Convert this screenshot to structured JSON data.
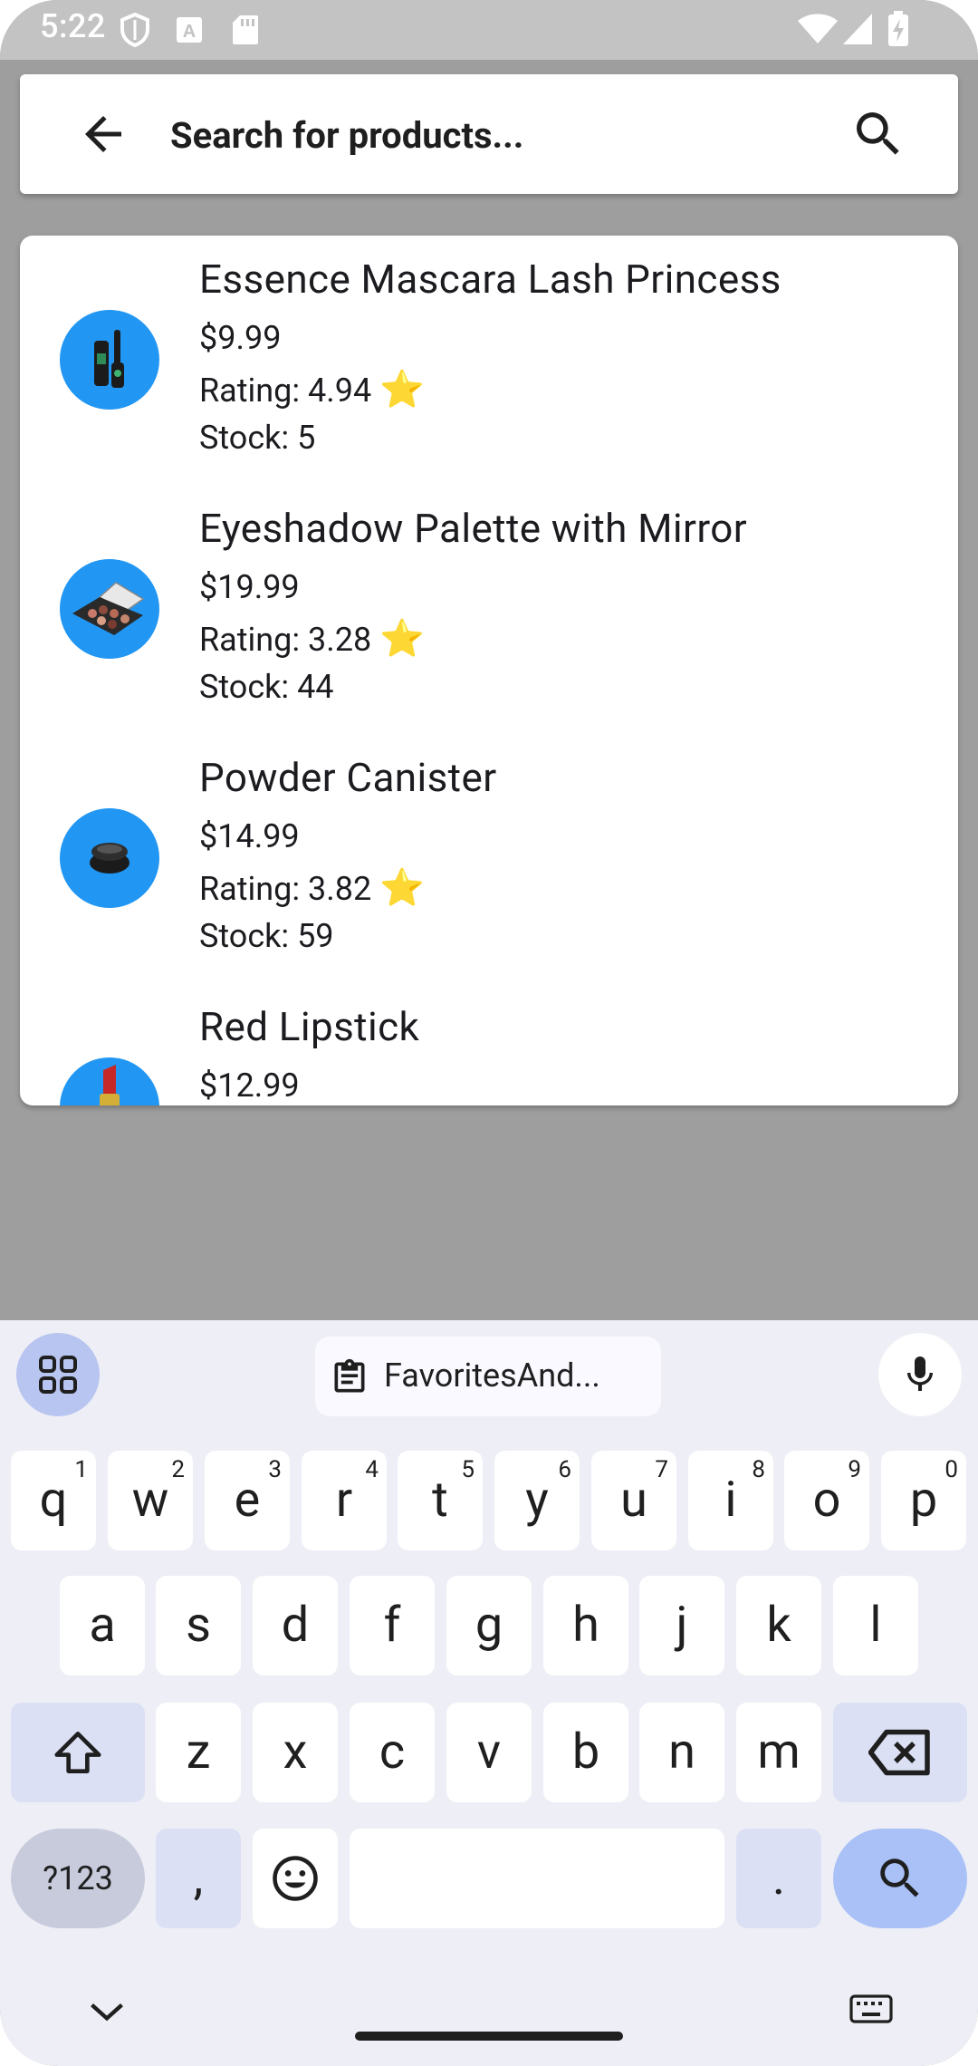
{
  "status_bar": {
    "time": "5:22",
    "icons": [
      "shield-icon",
      "a-icon",
      "sd-card-icon",
      "wifi-icon",
      "signal-icon",
      "battery-charging-icon"
    ]
  },
  "search": {
    "placeholder": "Search for products...",
    "back_icon": "arrow-back-icon",
    "search_icon": "search-icon"
  },
  "products": [
    {
      "name": "Essence Mascara Lash Princess",
      "price": "$9.99",
      "rating": "Rating: 4.94",
      "stock": "Stock: 5",
      "icon": "mascara-icon"
    },
    {
      "name": "Eyeshadow Palette with Mirror",
      "price": "$19.99",
      "rating": "Rating: 3.28",
      "stock": "Stock: 44",
      "icon": "eyeshadow-palette-icon"
    },
    {
      "name": "Powder Canister",
      "price": "$14.99",
      "rating": "Rating: 3.82",
      "stock": "Stock: 59",
      "icon": "powder-canister-icon"
    },
    {
      "name": "Red Lipstick",
      "price": "$12.99",
      "icon": "lipstick-icon"
    }
  ],
  "rating_star": "⭐",
  "keyboard": {
    "clipboard_suggestion": "FavoritesAnd...",
    "row1": [
      {
        "key": "q",
        "hint": "1"
      },
      {
        "key": "w",
        "hint": "2"
      },
      {
        "key": "e",
        "hint": "3"
      },
      {
        "key": "r",
        "hint": "4"
      },
      {
        "key": "t",
        "hint": "5"
      },
      {
        "key": "y",
        "hint": "6"
      },
      {
        "key": "u",
        "hint": "7"
      },
      {
        "key": "i",
        "hint": "8"
      },
      {
        "key": "o",
        "hint": "9"
      },
      {
        "key": "p",
        "hint": "0"
      }
    ],
    "row2": [
      "a",
      "s",
      "d",
      "f",
      "g",
      "h",
      "j",
      "k",
      "l"
    ],
    "row3": [
      "z",
      "x",
      "c",
      "v",
      "b",
      "n",
      "m"
    ],
    "symbols_label": "?123",
    "comma": ",",
    "period": "."
  }
}
